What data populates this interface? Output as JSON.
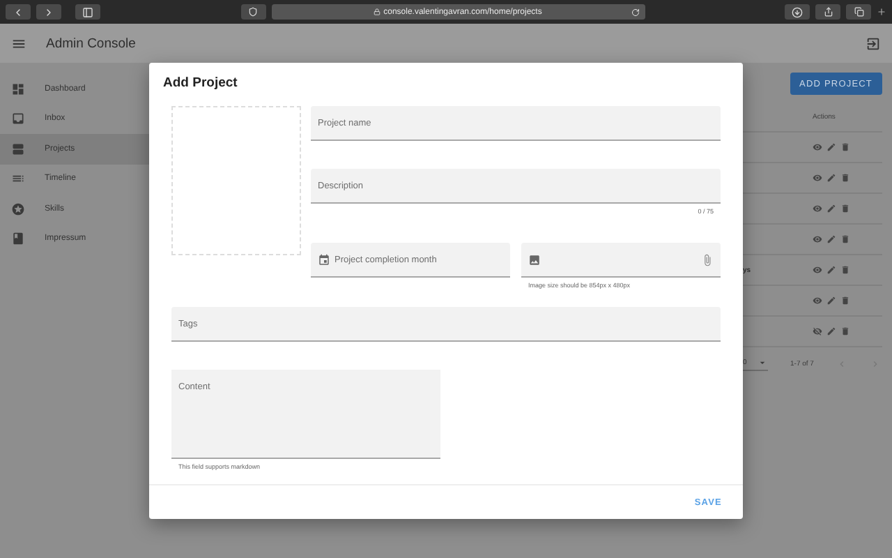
{
  "browser": {
    "url": "console.valentingavran.com/home/projects"
  },
  "app_bar": {
    "title": "Admin Console"
  },
  "sidebar": {
    "items": [
      {
        "label": "Dashboard",
        "selected": false
      },
      {
        "label": "Inbox",
        "selected": false
      },
      {
        "label": "Projects",
        "selected": true
      },
      {
        "label": "Timeline",
        "selected": false
      },
      {
        "label": "Skills",
        "selected": false
      },
      {
        "label": "Impressum",
        "selected": false
      }
    ]
  },
  "page": {
    "add_button": "ADD PROJECT",
    "table": {
      "actions_header": "Actions",
      "rows": [
        {
          "visible": true
        },
        {
          "visible": true
        },
        {
          "visible": true
        },
        {
          "visible": true
        },
        {
          "visible": true,
          "cell_tail": "ys"
        },
        {
          "visible": true
        },
        {
          "visible": false
        }
      ]
    },
    "pagination": {
      "rows_per_page": "0",
      "range": "1-7 of 7"
    }
  },
  "dialog": {
    "title": "Add Project",
    "name_field": {
      "placeholder": "Project name"
    },
    "description_field": {
      "placeholder": "Description",
      "counter": "0 / 75"
    },
    "month_field": {
      "placeholder": "Project completion month"
    },
    "image_field": {
      "hint": "Image size should be 854px x 480px"
    },
    "tags_field": {
      "placeholder": "Tags"
    },
    "content_field": {
      "placeholder": "Content",
      "hint": "This field supports markdown"
    },
    "save_button": "SAVE"
  }
}
